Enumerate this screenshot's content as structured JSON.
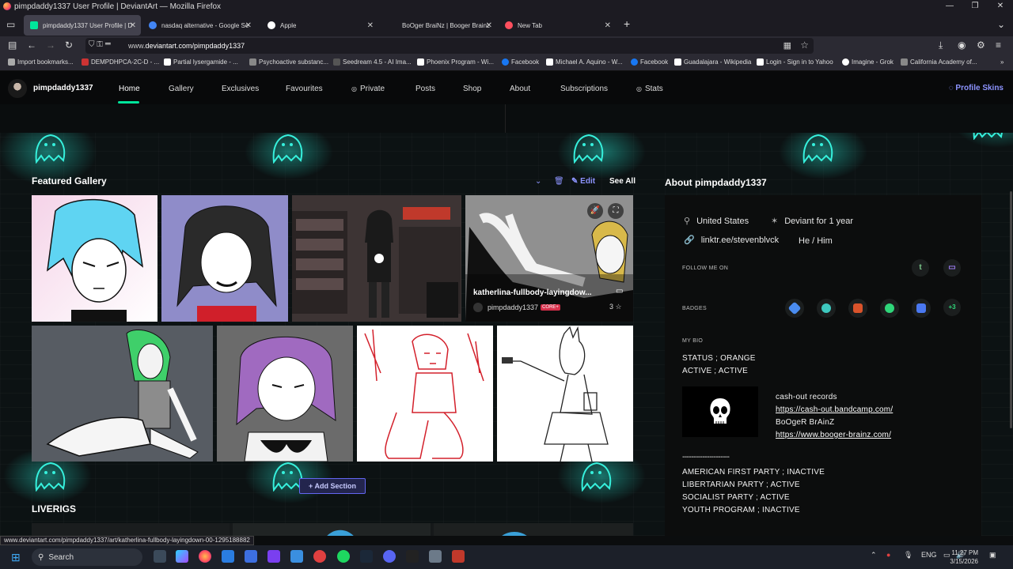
{
  "window": {
    "title": "pimpdaddy1337 User Profile | DeviantArt — Mozilla Firefox",
    "controls": [
      "—",
      "❐",
      "✕"
    ]
  },
  "tabs": [
    {
      "label": "pimpdaddy1337 User Profile | D",
      "active": true,
      "favicon_color": "#00e59b"
    },
    {
      "label": "nasdaq alternative - Google Se",
      "active": false,
      "favicon_color": "#4285f4"
    },
    {
      "label": "Apple",
      "active": false,
      "favicon_color": "#ffffff"
    },
    {
      "label": "BoOger BraiNz | Booger Brainz",
      "active": false,
      "favicon_color": "#1c1b22"
    },
    {
      "label": "New Tab",
      "active": false,
      "favicon_color": "#ff4f5e"
    }
  ],
  "new_tab_icon": "+",
  "navbar": {
    "url_prefix": "www.",
    "url": "deviantart.com/pimpdaddy1337",
    "icons": [
      "back-icon",
      "forward-icon",
      "reload-icon",
      "shield-icon",
      "bookmark-star-icon"
    ]
  },
  "bookmarks": [
    {
      "label": "Import bookmarks...",
      "color": "#aaaaaa"
    },
    {
      "label": "DEMPDHPCA-2C-D - ...",
      "color": "#cc3333"
    },
    {
      "label": "Partial lysergamide - ...",
      "color": "#ffffff"
    },
    {
      "label": "Psychoactive substanc...",
      "color": "#888888"
    },
    {
      "label": "Seedream 4.5 - AI Ima...",
      "color": "#333333"
    },
    {
      "label": "Phoenix Program - Wi...",
      "color": "#ffffff"
    },
    {
      "label": "Facebook",
      "color": "#1877f2"
    },
    {
      "label": "Michael A. Aquino - W...",
      "color": "#ffffff"
    },
    {
      "label": "Facebook",
      "color": "#1877f2"
    },
    {
      "label": "Guadalajara - Wikipedia",
      "color": "#ffffff"
    },
    {
      "label": "Login - Sign in to Yahoo",
      "color": "#ffffff"
    },
    {
      "label": "Imagine - Grok",
      "color": "#ffffff"
    },
    {
      "label": "California Academy of...",
      "color": "#888888"
    }
  ],
  "profile": {
    "username": "pimpdaddy1337",
    "nav": [
      "Home",
      "Gallery",
      "Exclusives",
      "Favourites",
      "Private",
      "Posts",
      "Shop",
      "About",
      "Subscriptions",
      "Stats"
    ],
    "active_nav": "Home",
    "profile_skins": "Profile Skins",
    "accent": "#00e59b"
  },
  "featured": {
    "title": "Featured Gallery",
    "edit": "Edit",
    "see_all": "See All",
    "hover_title": "katherlina-fullbody-layingdow...",
    "hover_user": "pimpdaddy1337",
    "hover_badge": "CORE+",
    "hover_count": "3",
    "add_section": "Add Section"
  },
  "about": {
    "title": "About pimpdaddy1337",
    "location": "United States",
    "deviant_for": "Deviant for 1 year",
    "link": "linktr.ee/stevenblvck",
    "pronouns": "He / Him",
    "follow_label": "FOLLOW ME ON",
    "social": [
      "t",
      "▭"
    ],
    "badges_label": "BADGES",
    "badge_more": "+3",
    "bio_label": "MY BIO",
    "bio_top": [
      "STATUS ; ORANGE",
      "ACTIVE ; ACTIVE"
    ],
    "bio_links": [
      {
        "text": "cash-out records",
        "link": false
      },
      {
        "text": "https://cash-out.bandcamp.com/",
        "link": true
      },
      {
        "text": "BoOgeR BrAinZ",
        "link": false
      },
      {
        "text": "https://www.booger-brainz.com/",
        "link": true
      }
    ],
    "separator": "---------------------",
    "bio_bottom": [
      "AMERICAN FIRST PARTY ; INACTIVE",
      "LIBERTARIAN PARTY ;  ACTIVE",
      "SOCIALIST PARTY ; ACTIVE",
      "YOUTH PROGRAM ; INACTIVE"
    ]
  },
  "liverigs": "LIVERIGS",
  "status_url": "www.deviantart.com/pimpdaddy1337/art/katherlina-fullbody-layingdown-00-1295188882",
  "taskbar": {
    "search": "Search",
    "lang": "ENG",
    "time": "11:27 PM",
    "date": "3/15/2026"
  }
}
